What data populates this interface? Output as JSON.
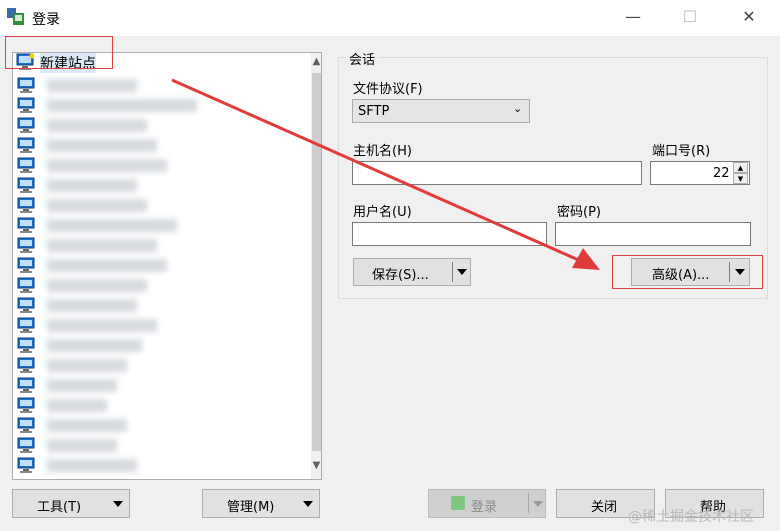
{
  "window": {
    "title": "登录",
    "minimize": "—",
    "maximize": "☐",
    "close": "✕"
  },
  "site_tree": {
    "new_site_label": "新建站点",
    "scroll_up": "▲",
    "scroll_down": "▼"
  },
  "session": {
    "group_label": "会话",
    "protocol_label": "文件协议(F)",
    "protocol_value": "SFTP",
    "host_label": "主机名(H)",
    "host_value": "",
    "port_label": "端口号(R)",
    "port_value": "22",
    "user_label": "用户名(U)",
    "user_value": "",
    "password_label": "密码(P)",
    "password_value": "",
    "save_button": "保存(S)...",
    "advanced_button": "高级(A)..."
  },
  "footer": {
    "tools_button": "工具(T)",
    "manage_button": "管理(M)",
    "login_button": "登录",
    "close_button": "关闭",
    "help_button": "帮助"
  },
  "watermark": "@稀土掘金技术社区",
  "colors": {
    "annotation": "#e04040",
    "arrow": "#e03c3c"
  }
}
